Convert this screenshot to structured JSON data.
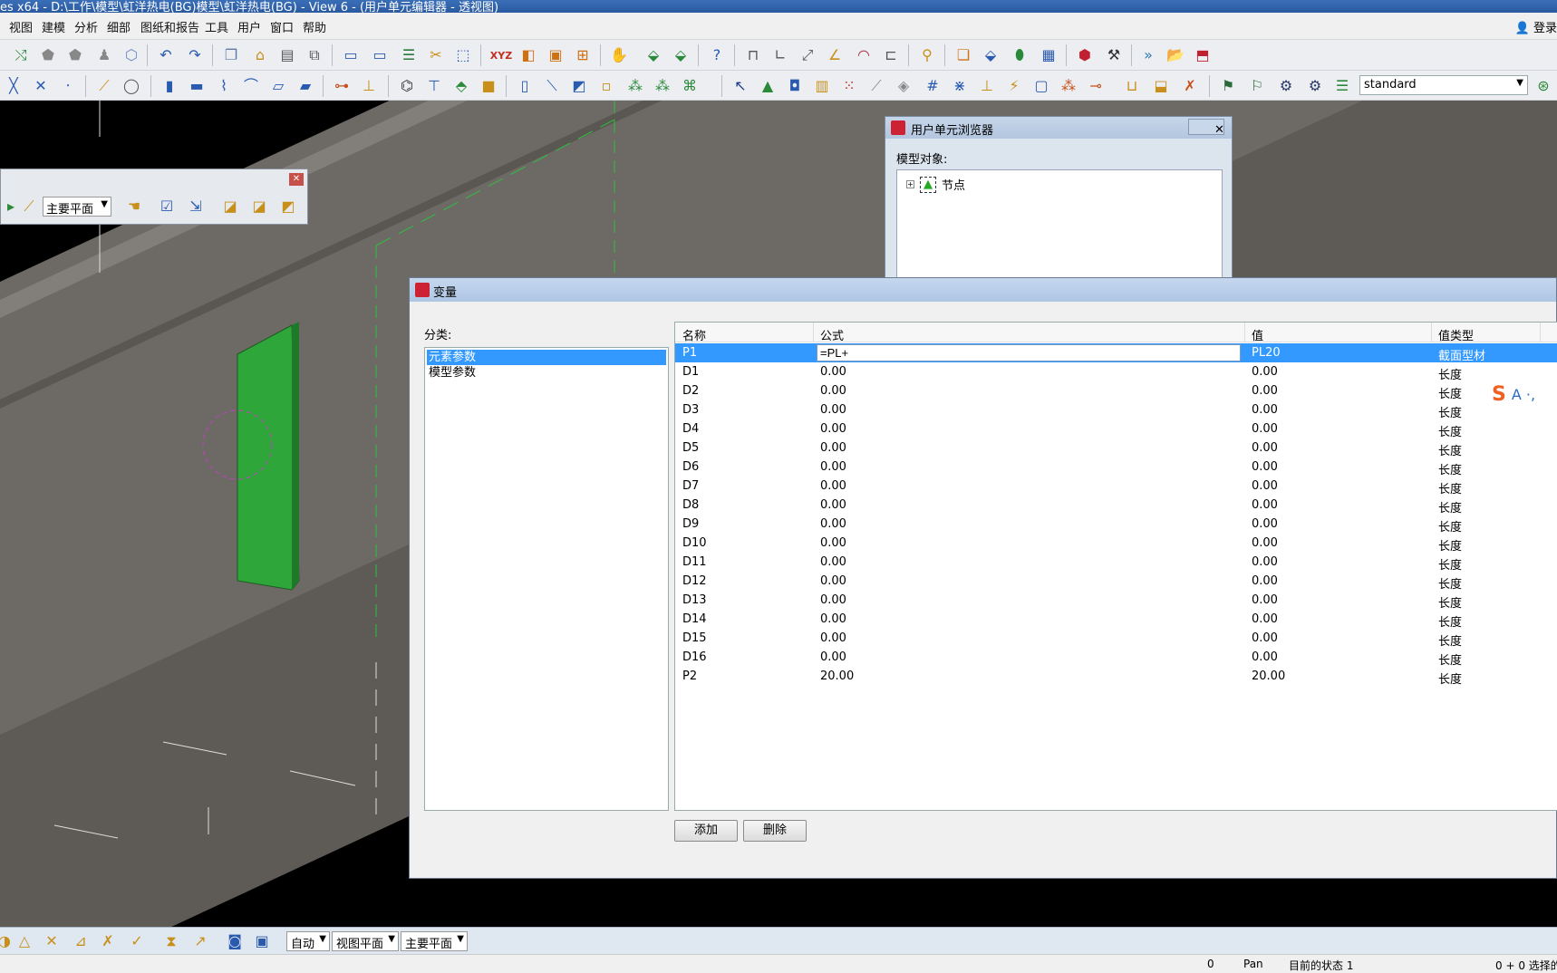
{
  "window": {
    "title": "es x64 - D:\\工作\\模型\\虹洋热电(BG)模型\\虹洋热电(BG)  - View 6 - (用户单元编辑器 - 透视图)"
  },
  "menu": {
    "items": [
      "视图",
      "建模",
      "分析",
      "细部",
      "图纸和报告",
      "工具",
      "用户",
      "窗口",
      "帮助"
    ],
    "login": "登录"
  },
  "toolbar": {
    "profile_select": "standard"
  },
  "float_toolbar": {
    "plane_select": "主要平面"
  },
  "cell_browser": {
    "title": "用户单元浏览器",
    "close": "✕",
    "model_objects_label": "模型对象:",
    "tree_node": "节点"
  },
  "variables_dialog": {
    "title": "变量",
    "category_label": "分类:",
    "categories": [
      {
        "label": "元素参数",
        "selected": true
      },
      {
        "label": "模型参数",
        "selected": false
      }
    ],
    "columns": [
      "名称",
      "公式",
      "值",
      "值类型"
    ],
    "rows": [
      {
        "name": "P1",
        "formula": "=PL+",
        "value": "PL20",
        "type": "截面型材",
        "selected": true,
        "editing": true
      },
      {
        "name": "D1",
        "formula": "0.00",
        "value": "0.00",
        "type": "长度"
      },
      {
        "name": "D2",
        "formula": "0.00",
        "value": "0.00",
        "type": "长度"
      },
      {
        "name": "D3",
        "formula": "0.00",
        "value": "0.00",
        "type": "长度"
      },
      {
        "name": "D4",
        "formula": "0.00",
        "value": "0.00",
        "type": "长度"
      },
      {
        "name": "D5",
        "formula": "0.00",
        "value": "0.00",
        "type": "长度"
      },
      {
        "name": "D6",
        "formula": "0.00",
        "value": "0.00",
        "type": "长度"
      },
      {
        "name": "D7",
        "formula": "0.00",
        "value": "0.00",
        "type": "长度"
      },
      {
        "name": "D8",
        "formula": "0.00",
        "value": "0.00",
        "type": "长度"
      },
      {
        "name": "D9",
        "formula": "0.00",
        "value": "0.00",
        "type": "长度"
      },
      {
        "name": "D10",
        "formula": "0.00",
        "value": "0.00",
        "type": "长度"
      },
      {
        "name": "D11",
        "formula": "0.00",
        "value": "0.00",
        "type": "长度"
      },
      {
        "name": "D12",
        "formula": "0.00",
        "value": "0.00",
        "type": "长度"
      },
      {
        "name": "D13",
        "formula": "0.00",
        "value": "0.00",
        "type": "长度"
      },
      {
        "name": "D14",
        "formula": "0.00",
        "value": "0.00",
        "type": "长度"
      },
      {
        "name": "D15",
        "formula": "0.00",
        "value": "0.00",
        "type": "长度"
      },
      {
        "name": "D16",
        "formula": "0.00",
        "value": "0.00",
        "type": "长度"
      },
      {
        "name": "P2",
        "formula": "20.00",
        "value": "20.00",
        "type": "长度"
      }
    ],
    "add_button": "添加",
    "delete_button": "删除"
  },
  "bottom_toolbar": {
    "select_auto": "自动",
    "select_view_plane": "视图平面",
    "select_main_plane": "主要平面"
  },
  "status": {
    "count": "0",
    "mode": "Pan",
    "current_state": "目前的状态 1",
    "selection": "0 + 0 选择的"
  }
}
